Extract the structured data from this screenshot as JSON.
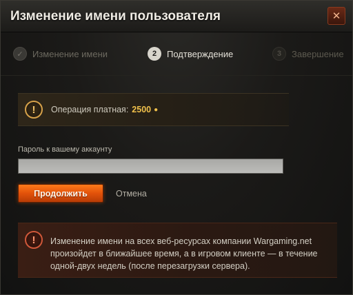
{
  "dialog": {
    "title": "Изменение имени пользователя",
    "close_icon": "close-icon",
    "close_glyph": "✕"
  },
  "steps": [
    {
      "marker": "✓",
      "label": "Изменение имени",
      "state": "completed"
    },
    {
      "marker": "2",
      "label": "Подтверждение",
      "state": "active"
    },
    {
      "marker": "3",
      "label": "Завершение",
      "state": "pending"
    }
  ],
  "cost": {
    "icon": "warning-icon",
    "icon_glyph": "!",
    "label": "Операция платная:",
    "amount": "2500",
    "currency_icon": "gold-coin-icon",
    "currency_glyph": "●"
  },
  "password": {
    "label": "Пароль к вашему аккаунту",
    "value": "",
    "placeholder": ""
  },
  "actions": {
    "continue_label": "Продолжить",
    "cancel_label": "Отмена"
  },
  "notice": {
    "icon": "warning-icon",
    "icon_glyph": "!",
    "text": "Изменение имени на всех веб-ресурсах компании Wargaming.net произойдет в ближайшее время, а в игровом клиенте — в течение одной-двух недель (после перезагрузки сервера)."
  },
  "colors": {
    "accent": "#e2520a",
    "gold": "#f0c04b",
    "warning_border": "#d7a24a",
    "alert_border": "#d0583a"
  }
}
